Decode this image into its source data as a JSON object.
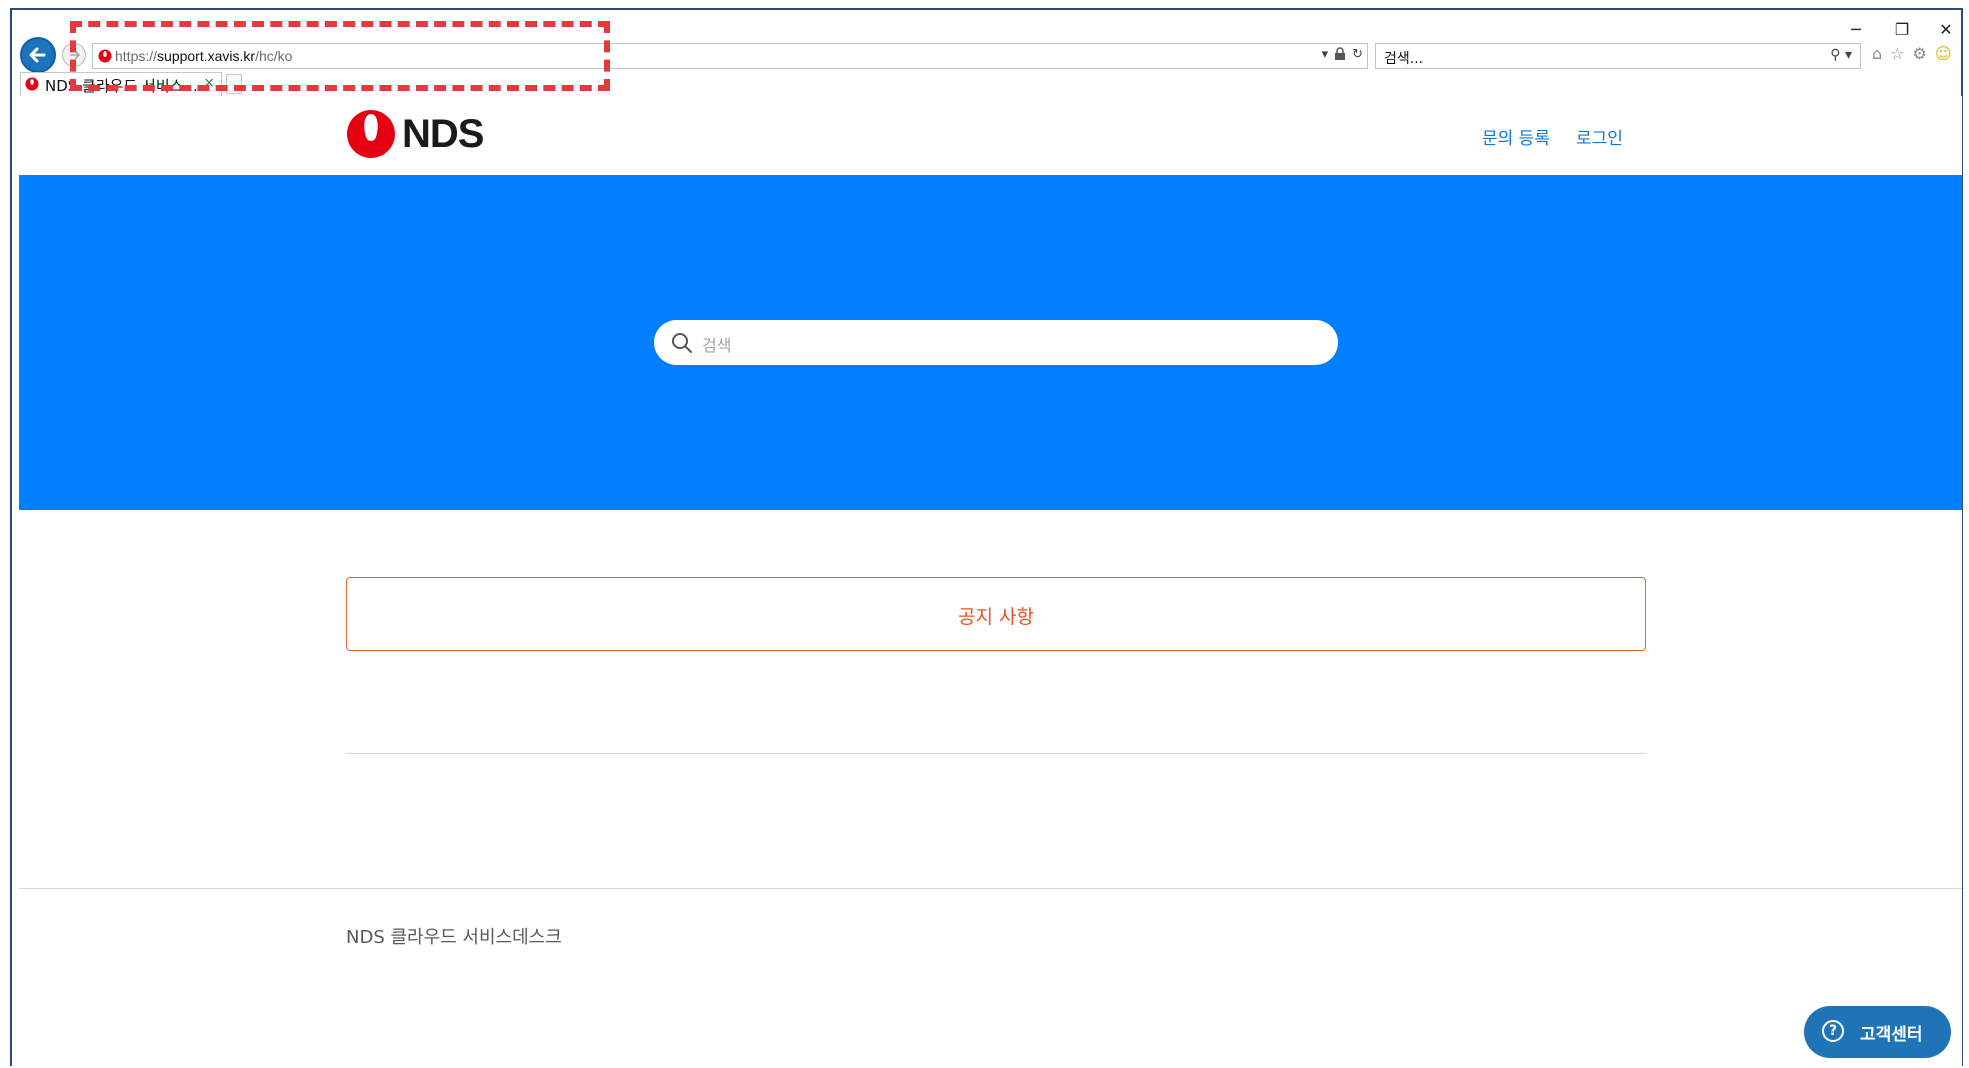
{
  "browser": {
    "address": {
      "scheme": "https://",
      "host": "support.xavis.kr",
      "path": "/hc/ko"
    },
    "search_placeholder": "검색...",
    "tab": {
      "title": "NDS 클라우드 서비스...",
      "close": "×"
    },
    "window_controls": {
      "minimize": "─",
      "restore": "❐",
      "close": "✕"
    }
  },
  "header": {
    "logo_text": "NDS",
    "nav": [
      "문의 등록",
      "로그인"
    ]
  },
  "hero": {
    "search_placeholder": "검색"
  },
  "sections": {
    "notice_label": "공지 사항"
  },
  "footer": {
    "text": "NDS 클라우드 서비스데스크"
  },
  "widget": {
    "help_icon": "?",
    "help_label": "고객센터"
  },
  "colors": {
    "brand_blue": "#007ffe",
    "link_blue": "#0b79d6",
    "notice_orange": "#ee4f23",
    "logo_red": "#e50012",
    "annotation_red": "#e5393d"
  },
  "icons": {
    "back": "back-arrow-icon",
    "forward": "forward-arrow-icon",
    "search": "search-icon",
    "home": "home-icon",
    "favorites": "star-icon",
    "settings": "gear-icon",
    "feedback": "smiley-icon"
  }
}
